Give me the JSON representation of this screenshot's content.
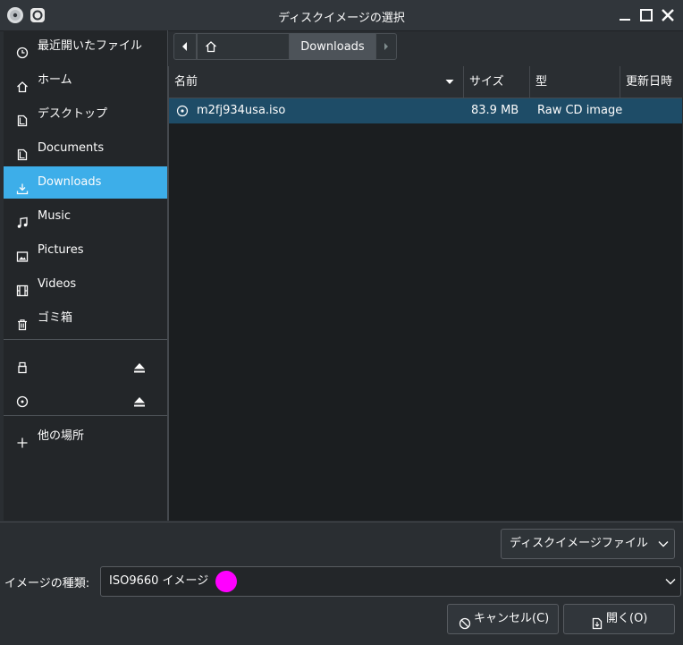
{
  "window": {
    "title": "ディスクイメージの選択"
  },
  "sidebar": {
    "places": [
      {
        "label": "最近開いたファイル",
        "icon": "clock-icon"
      },
      {
        "label": "ホーム",
        "icon": "home-icon"
      },
      {
        "label": "デスクトップ",
        "icon": "desktop-icon"
      },
      {
        "label": "Documents",
        "icon": "document-icon"
      },
      {
        "label": "Downloads",
        "icon": "download-icon",
        "active": true
      },
      {
        "label": "Music",
        "icon": "music-icon"
      },
      {
        "label": "Pictures",
        "icon": "picture-icon"
      },
      {
        "label": "Videos",
        "icon": "video-icon"
      },
      {
        "label": "ゴミ箱",
        "icon": "trash-icon"
      }
    ],
    "other_places_label": "他の場所"
  },
  "pathbar": {
    "current": "Downloads"
  },
  "file_list": {
    "columns": [
      "名前",
      "サイズ",
      "型",
      "更新日時"
    ],
    "rows": [
      {
        "name": "m2fj934usa.iso",
        "size": "83.9 MB",
        "type": "Raw CD image",
        "icon": "disc-icon"
      }
    ]
  },
  "filter": {
    "selected": "ディスクイメージファイル"
  },
  "image_type": {
    "label": "イメージの種類:",
    "selected": "ISO9660 イメージ"
  },
  "buttons": {
    "cancel": "キャンセル(C)",
    "open": "開く(O)"
  },
  "colors": {
    "accent": "#3daee9",
    "selection": "#1e4c67",
    "cursor_marker": "#ff00ff"
  }
}
